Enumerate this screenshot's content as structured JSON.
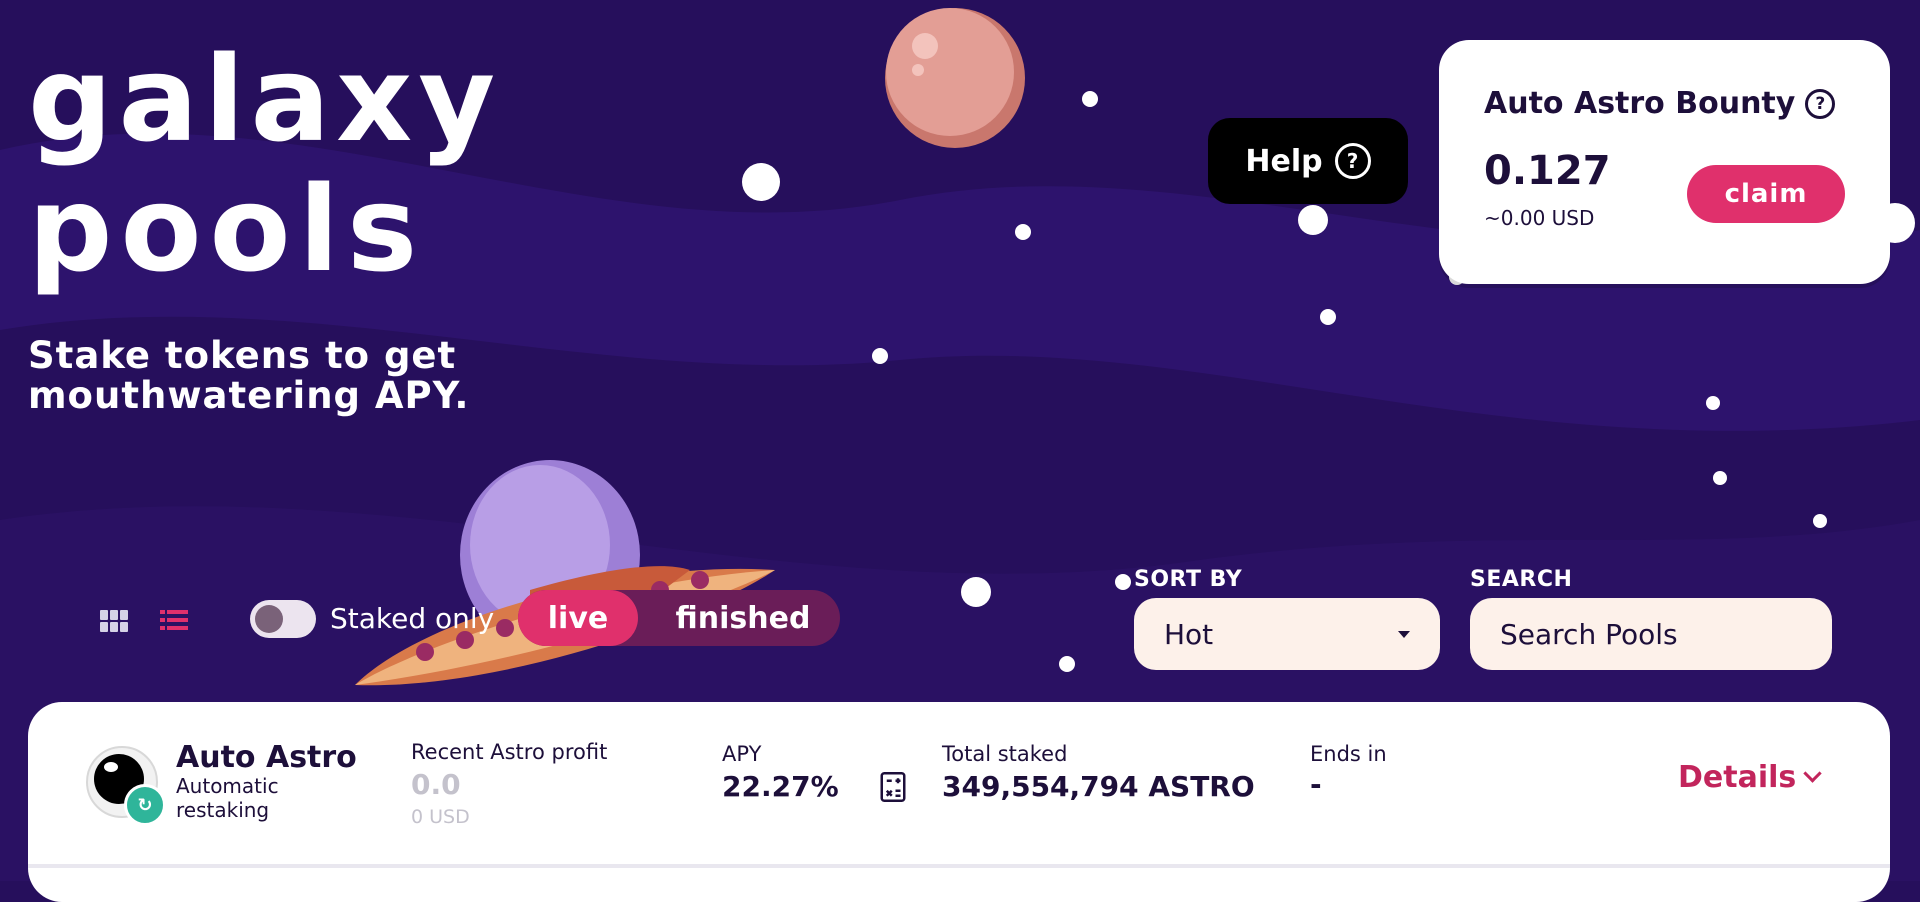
{
  "hero": {
    "title_line1": "galaxy",
    "title_line2": "pools",
    "subtitle": "Stake tokens to get mouthwatering APY."
  },
  "help": {
    "label": "Help",
    "icon": "question-circle-icon"
  },
  "bounty": {
    "title": "Auto Astro Bounty",
    "value": "0.127",
    "usd": "~0.00 USD",
    "claim_label": "claim"
  },
  "controls": {
    "staked_only_label": "Staked only",
    "staked_only_on": false,
    "tabs": [
      {
        "label": "live",
        "active": true
      },
      {
        "label": "finished",
        "active": false
      }
    ],
    "sort_label": "SORT BY",
    "sort_value": "Hot",
    "search_label": "SEARCH",
    "search_placeholder": "Search Pools"
  },
  "pool": {
    "name": "Auto Astro",
    "subtitle": "Automatic restaking",
    "profit_label": "Recent Astro profit",
    "profit_value": "0.0",
    "profit_usd": "0 USD",
    "apy_label": "APY",
    "apy_value": "22.27%",
    "total_staked_label": "Total staked",
    "total_staked_value": "349,554,794 ASTRO",
    "ends_label": "Ends in",
    "ends_value": "-",
    "details_label": "Details"
  },
  "colors": {
    "background": "#260f5c",
    "accent": "#e0306c",
    "card": "#ffffff",
    "input": "#fdf1ea",
    "text_dark": "#1d0f3a"
  }
}
